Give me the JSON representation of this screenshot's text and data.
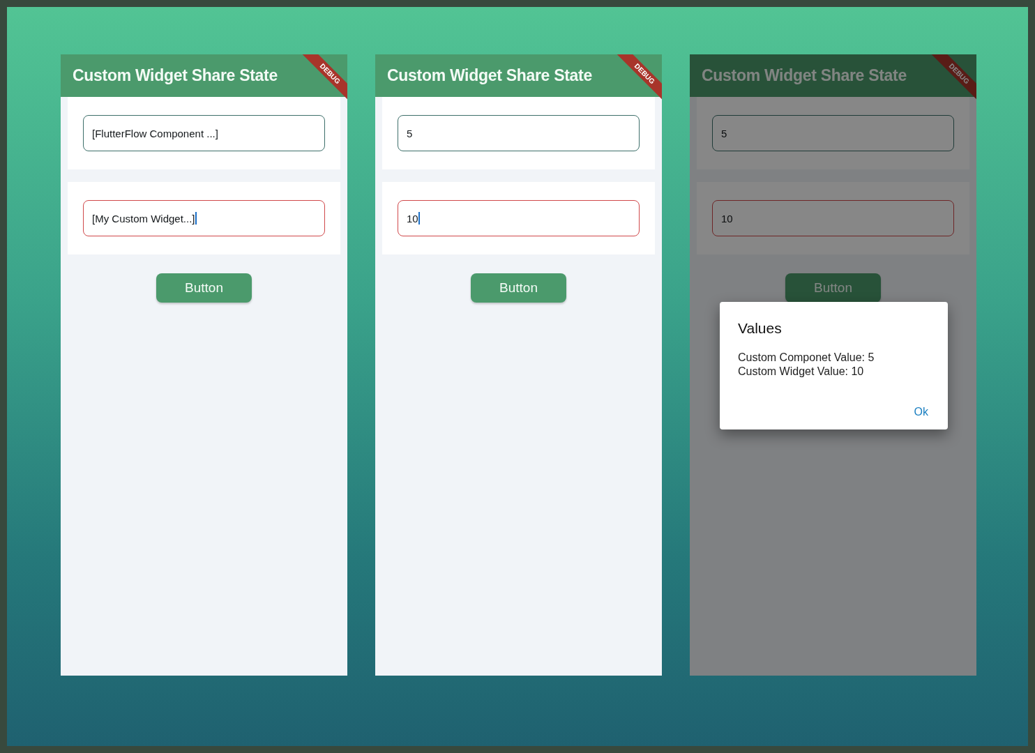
{
  "screens": [
    {
      "title": "Custom Widget Share State",
      "banner": "DEBUG",
      "dimmed": false,
      "fields": [
        {
          "kind": "component",
          "value": "[FlutterFlow Component ...]",
          "focused": false
        },
        {
          "kind": "widget",
          "value": "[My Custom Widget...]",
          "focused": true
        }
      ],
      "button": "Button"
    },
    {
      "title": "Custom Widget Share State",
      "banner": "DEBUG",
      "dimmed": false,
      "fields": [
        {
          "kind": "component",
          "value": "5",
          "focused": false
        },
        {
          "kind": "widget",
          "value": "10",
          "focused": true
        }
      ],
      "button": "Button"
    },
    {
      "title": "Custom Widget Share State",
      "banner": "DEBUG",
      "dimmed": true,
      "fields": [
        {
          "kind": "component",
          "value": "5",
          "focused": false
        },
        {
          "kind": "widget",
          "value": "10",
          "focused": false
        }
      ],
      "button": "Button",
      "dialog": {
        "title": "Values",
        "lines": [
          "Custom Componet Value: 5",
          "Custom Widget Value: 10"
        ],
        "action": "Ok"
      }
    }
  ]
}
